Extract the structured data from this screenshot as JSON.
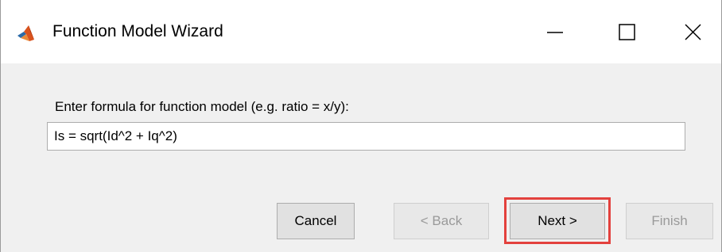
{
  "window": {
    "title": "Function Model Wizard",
    "icon": "matlab-icon"
  },
  "titlebar_controls": {
    "minimize_icon": "minimize-icon",
    "maximize_icon": "maximize-icon",
    "close_icon": "close-icon"
  },
  "form": {
    "label": "Enter formula for function model (e.g. ratio = x/y):",
    "formula_value": "Is = sqrt(Id^2 + Iq^2)"
  },
  "buttons": {
    "cancel": "Cancel",
    "back": "< Back",
    "next": "Next >",
    "finish": "Finish"
  },
  "colors": {
    "highlight": "#e3413d",
    "disabled_text": "#9a9a9a"
  }
}
